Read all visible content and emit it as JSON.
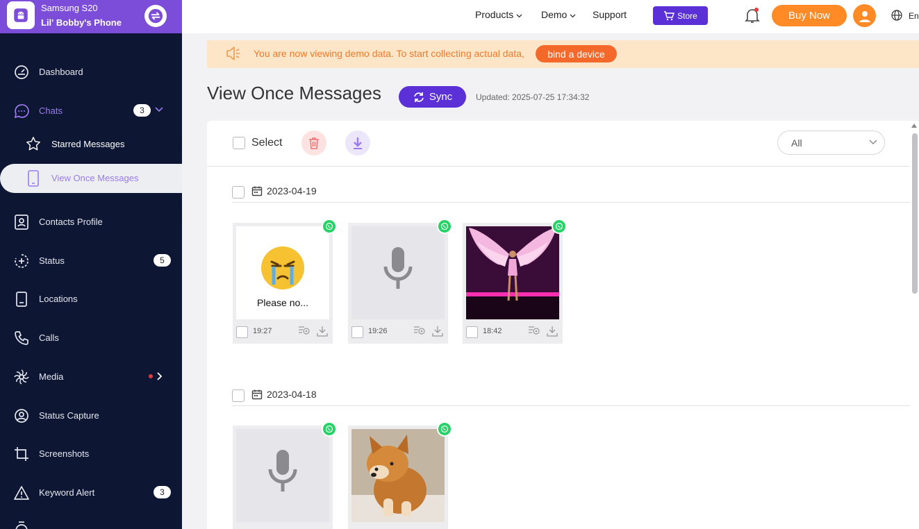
{
  "device": {
    "model": "Samsung S20",
    "name": "Lil' Bobby's Phone"
  },
  "sidebar": {
    "items": [
      {
        "label": "Dashboard",
        "icon": "dashboard-icon"
      },
      {
        "label": "Chats",
        "icon": "chat-icon",
        "badge": "3"
      },
      {
        "label": "Starred Messages",
        "icon": "star-icon"
      },
      {
        "label": "View Once Messages",
        "icon": "phone-icon"
      },
      {
        "label": "Contacts Profile",
        "icon": "contact-icon"
      },
      {
        "label": "Status",
        "icon": "status-icon",
        "badge": "5"
      },
      {
        "label": "Locations",
        "icon": "location-icon"
      },
      {
        "label": "Calls",
        "icon": "phone-call-icon"
      },
      {
        "label": "Media",
        "icon": "media-icon"
      },
      {
        "label": "Status Capture",
        "icon": "status-capture-icon"
      },
      {
        "label": "Screenshots",
        "icon": "crop-icon"
      },
      {
        "label": "Keyword Alert",
        "icon": "alert-icon",
        "badge": "3"
      }
    ]
  },
  "header": {
    "nav": [
      "Products",
      "Demo",
      "Support"
    ],
    "store": "Store",
    "buy": "Buy Now",
    "lang": "En"
  },
  "banner": {
    "message": "You are now viewing demo data. To start collecting actual data,",
    "action": "bind a device"
  },
  "page": {
    "title": "View Once Messages",
    "sync": "Sync",
    "updated": "Updated: 2025-07-25 17:34:32"
  },
  "toolbar": {
    "select": "Select",
    "filter": "All"
  },
  "groups": [
    {
      "date": "2023-04-19",
      "items": [
        {
          "type": "sticker",
          "caption": "Please no...",
          "time": "19:27"
        },
        {
          "type": "audio",
          "time": "19:26"
        },
        {
          "type": "photo",
          "subject": "runway-angel-wings",
          "time": "18:42"
        }
      ]
    },
    {
      "date": "2023-04-18",
      "items": [
        {
          "type": "audio"
        },
        {
          "type": "photo",
          "subject": "shiba-puppy"
        }
      ]
    }
  ],
  "colors": {
    "sidebar": "#0d1633",
    "accent": "#5b30d6",
    "orange": "#ff8a26",
    "whatsapp": "#25d366"
  }
}
